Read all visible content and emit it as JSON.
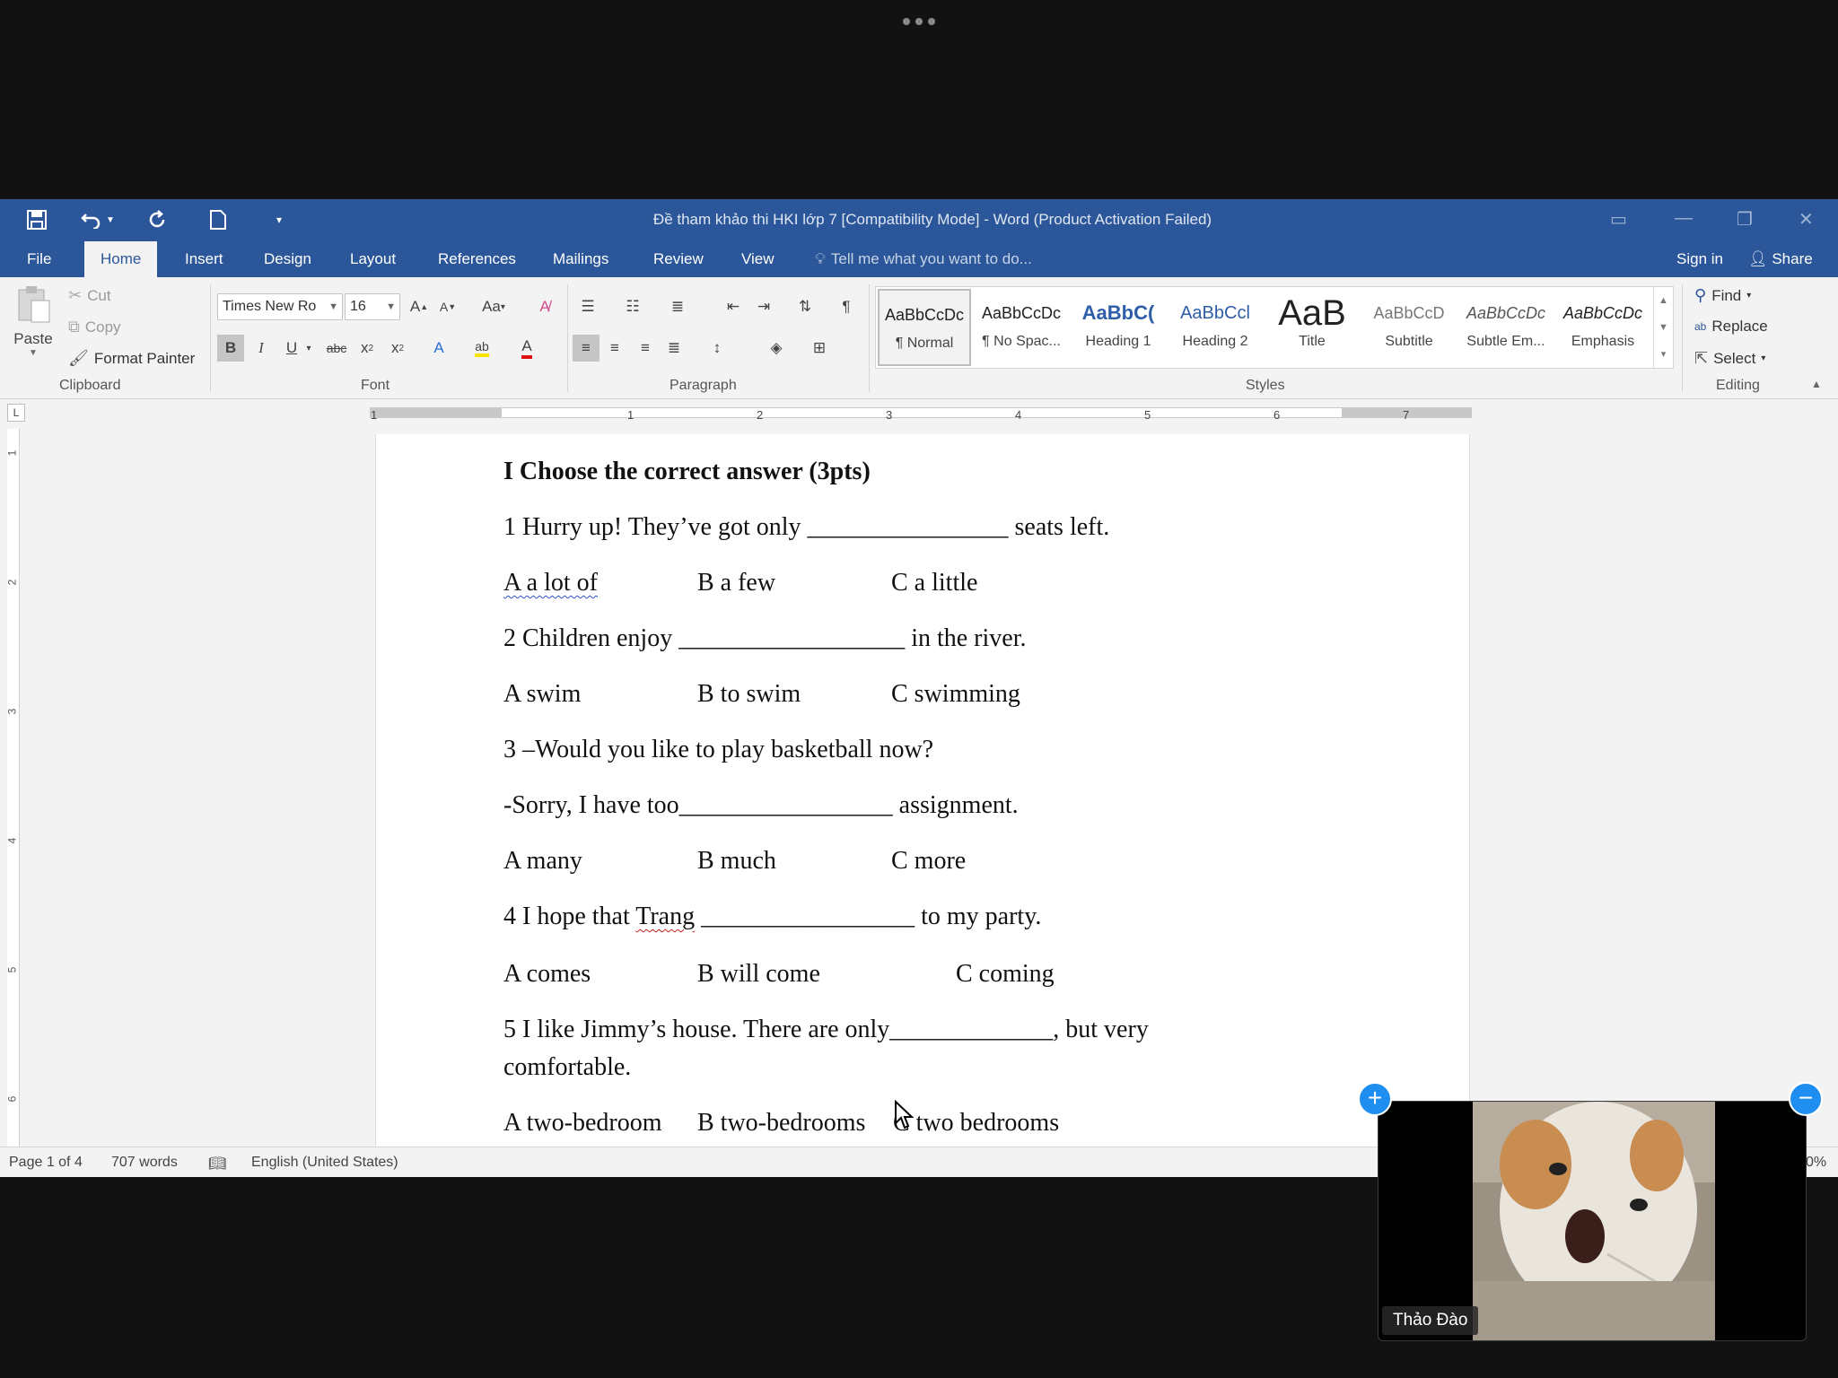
{
  "qat": {
    "save_icon": "save-icon",
    "undo_icon": "undo-icon",
    "redo_icon": "redo-icon",
    "new_icon": "new-document-icon",
    "customize_icon": "customize-qat-icon"
  },
  "title": "Đề tham khảo thi HKI lớp 7 [Compatibility Mode] - Word (Product Activation Failed)",
  "tabs": [
    "File",
    "Home",
    "Insert",
    "Design",
    "Layout",
    "References",
    "Mailings",
    "Review",
    "View"
  ],
  "tell_me": "Tell me what you want to do...",
  "sign_in": "Sign in",
  "share": "Share",
  "clipboard": {
    "paste": "Paste",
    "cut": "Cut",
    "copy": "Copy",
    "format_painter": "Format Painter",
    "label": "Clipboard"
  },
  "font": {
    "name": "Times New Ro",
    "size": "16",
    "change_case": "Aa",
    "label": "Font"
  },
  "paragraph": {
    "label": "Paragraph"
  },
  "styles": {
    "label": "Styles",
    "items": [
      {
        "preview": "AaBbCcDc",
        "name": "¶ Normal"
      },
      {
        "preview": "AaBbCcDc",
        "name": "¶ No Spac..."
      },
      {
        "preview": "AaBbC(",
        "name": "Heading 1"
      },
      {
        "preview": "AaBbCcl",
        "name": "Heading 2"
      },
      {
        "preview": "AaB",
        "name": "Title"
      },
      {
        "preview": "AaBbCcD",
        "name": "Subtitle"
      },
      {
        "preview": "AaBbCcDc",
        "name": "Subtle Em..."
      },
      {
        "preview": "AaBbCcDc",
        "name": "Emphasis"
      }
    ]
  },
  "editing": {
    "find": "Find",
    "replace": "Replace",
    "select": "Select",
    "label": "Editing"
  },
  "ruler": {
    "h_numbers": [
      "1",
      "1",
      "2",
      "3",
      "4",
      "5",
      "6",
      "7"
    ],
    "v_numbers": [
      "1",
      "2",
      "3",
      "4",
      "5",
      "6"
    ]
  },
  "document": {
    "heading": "I Choose the correct answer (3pts)",
    "q1": "1 Hurry up! They’ve got only ________________ seats left.",
    "q1_opts": [
      "A a lot of",
      "B a few",
      "C a little"
    ],
    "q2": "2 Children enjoy __________________ in the river.",
    "q2_opts": [
      "A swim",
      "B to swim",
      "C swimming"
    ],
    "q3a": "3 –Would you like to play basketball now?",
    "q3b": "-Sorry, I have too_________________ assignment.",
    "q3_opts": [
      "A many",
      "B much",
      "C more"
    ],
    "q4_pre": "4 I hope that ",
    "q4_name": "Trang",
    "q4_post": " _________________ to my party.",
    "q4_opts": [
      "A comes",
      "B will come",
      "C coming"
    ],
    "q5a": "5 I like Jimmy’s house. There are only_____________, but very",
    "q5b": "comfortable.",
    "q5_opts": [
      "A two-bedroom",
      "B two-bedrooms",
      "C two bedrooms"
    ]
  },
  "status": {
    "page": "Page 1 of 4",
    "words": "707 words",
    "language": "English (United States)",
    "zoom": "0%"
  },
  "video": {
    "name": "Thảo Đào",
    "plus": "+",
    "minus": "−"
  },
  "colors": {
    "word_blue": "#2b579a",
    "video_btn": "#1f8ef1"
  }
}
